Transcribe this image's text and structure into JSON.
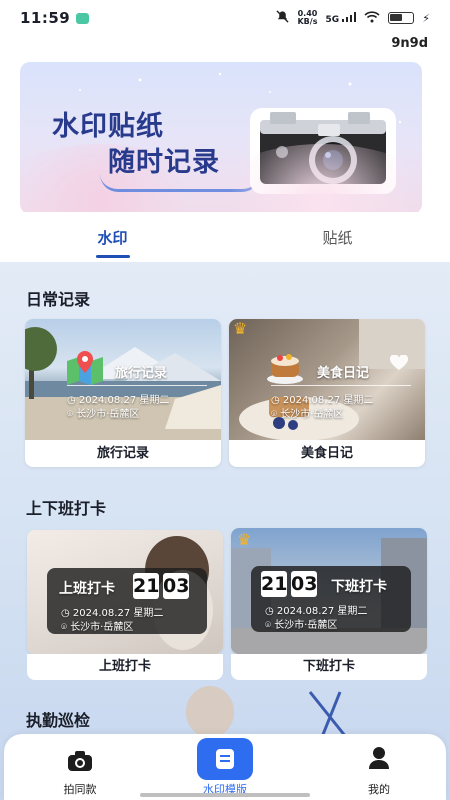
{
  "status_bar": {
    "time": "11:59",
    "net_speed_value": "0.40",
    "net_speed_unit": "KB/s",
    "signal": "5G",
    "app_code": "9n9d"
  },
  "banner": {
    "line1": "水印贴纸",
    "line2": "随时记录"
  },
  "tabs": [
    {
      "label": "水印",
      "active": true
    },
    {
      "label": "贴纸",
      "active": false
    }
  ],
  "sections": {
    "daily": "日常记录",
    "commute": "上下班打卡",
    "patrol": "执勤巡检"
  },
  "cards": {
    "travel": {
      "label": "旅行记录",
      "wm_title": "旅行记录",
      "date": "2024.08.27 星期二",
      "location": "长沙市·岳麓区"
    },
    "food": {
      "label": "美食日记",
      "wm_title": "美食日记",
      "date": "2024.08.27 星期二",
      "location": "长沙市·岳麓区"
    },
    "clock_in": {
      "label": "上班打卡",
      "wm_title": "上班打卡",
      "hour": "21",
      "minute": "03",
      "date": "2024.08.27 星期二",
      "location": "长沙市·岳麓区"
    },
    "clock_out": {
      "label": "下班打卡",
      "wm_title": "下班打卡",
      "hour": "21",
      "minute": "03",
      "date": "2024.08.27 星期二",
      "location": "长沙市·岳麓区"
    }
  },
  "bottom_nav": [
    {
      "label": "拍同款",
      "icon": "camera-icon"
    },
    {
      "label": "水印模版",
      "icon": "document-icon",
      "active": true
    },
    {
      "label": "我的",
      "icon": "user-icon"
    }
  ],
  "colors": {
    "accent": "#2f6df0",
    "tab_active": "#1f4fb4",
    "banner_text": "#283a8c"
  }
}
